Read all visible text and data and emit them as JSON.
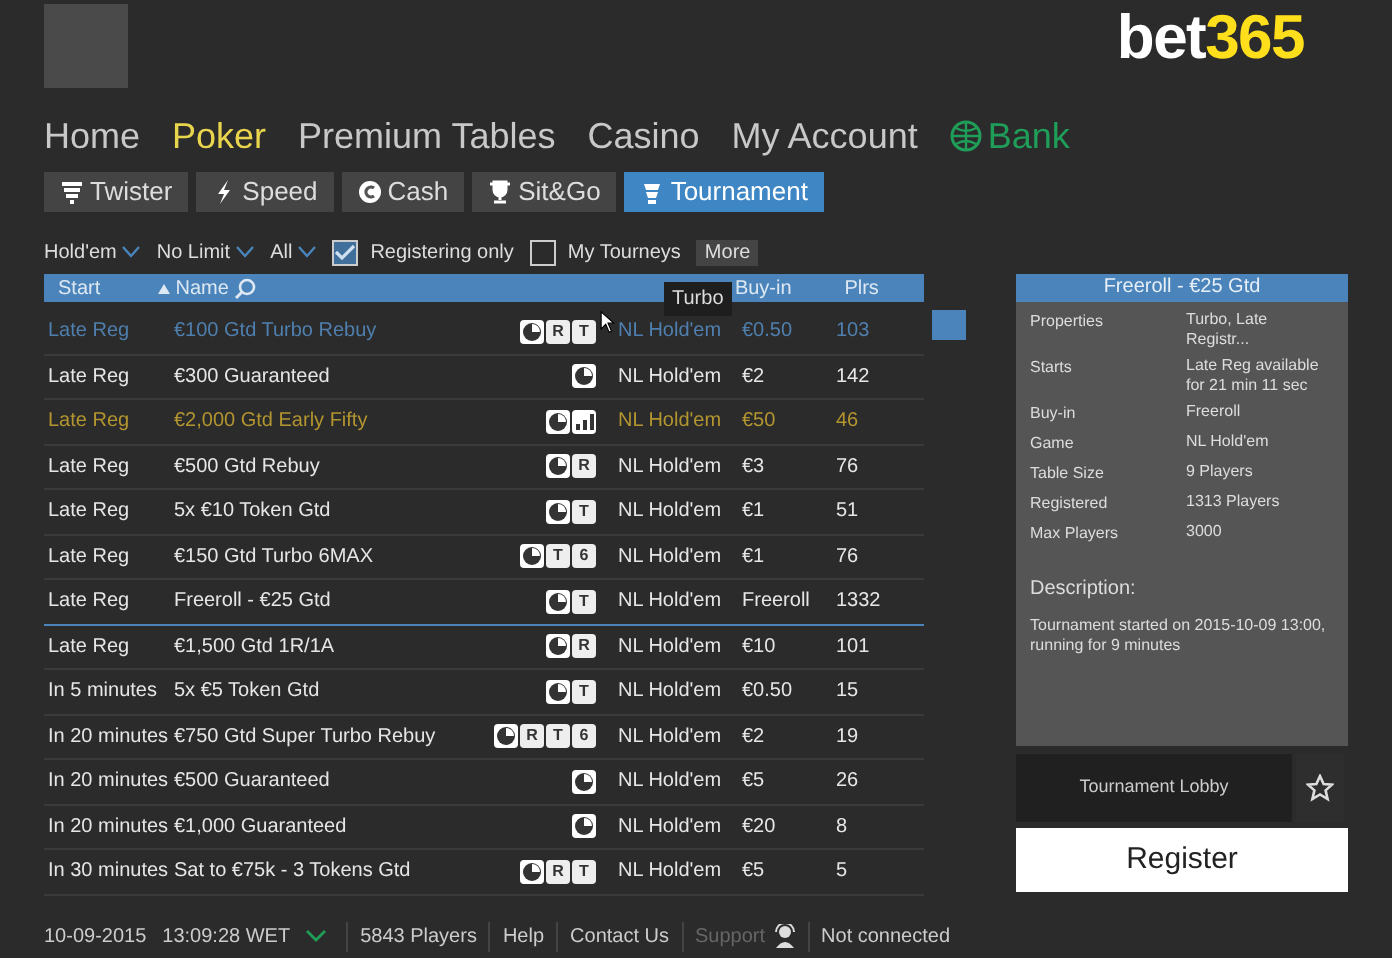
{
  "logo": {
    "main": "bet",
    "accent": "365"
  },
  "nav": [
    {
      "label": "Home",
      "selected": false
    },
    {
      "label": "Poker",
      "selected": true
    },
    {
      "label": "Premium Tables",
      "selected": false
    },
    {
      "label": "Casino",
      "selected": false
    },
    {
      "label": "My Account",
      "selected": false
    },
    {
      "label": "Bank",
      "selected": false,
      "kind": "bank"
    }
  ],
  "tabs": [
    {
      "label": "Twister",
      "selected": false
    },
    {
      "label": "Speed",
      "selected": false
    },
    {
      "label": "Cash",
      "selected": false
    },
    {
      "label": "Sit&Go",
      "selected": false
    },
    {
      "label": "Tournament",
      "selected": true
    }
  ],
  "filters": [
    {
      "kind": "dropdown",
      "label": "Hold'em"
    },
    {
      "kind": "dropdown",
      "label": "No Limit"
    },
    {
      "kind": "dropdown",
      "label": "All"
    },
    {
      "kind": "checkbox",
      "label": "Registering only",
      "checked": true
    },
    {
      "kind": "checkbox",
      "label": "My Tourneys",
      "checked": false
    },
    {
      "kind": "button",
      "label": "More"
    }
  ],
  "table": {
    "columns": [
      "Start",
      "Name",
      "Buy-in",
      "Plrs"
    ],
    "tooltip": "Turbo",
    "rows": [
      {
        "start": "Late Reg",
        "name": "€100 Gtd Turbo Rebuy",
        "badges": [
          {
            "kind": "clock"
          },
          {
            "kind": "letter",
            "text": "R"
          },
          {
            "kind": "letter",
            "text": "T"
          }
        ],
        "game": "NL Hold'em",
        "buyin": "€0.50",
        "players": "103",
        "color": "#4f7fae",
        "selected": false
      },
      {
        "start": "Late Reg",
        "name": "€300 Guaranteed",
        "badges": [
          {
            "kind": "clock"
          }
        ],
        "game": "NL Hold'em",
        "buyin": "€2",
        "players": "142",
        "color": "#e6e6e6",
        "selected": false
      },
      {
        "start": "Late Reg",
        "name": "€2,000 Gtd Early Fifty",
        "badges": [
          {
            "kind": "clock"
          },
          {
            "kind": "bars"
          }
        ],
        "game": "NL Hold'em",
        "buyin": "€50",
        "players": "46",
        "color": "#b3952f",
        "selected": false
      },
      {
        "start": "Late Reg",
        "name": "€500 Gtd Rebuy",
        "badges": [
          {
            "kind": "clock"
          },
          {
            "kind": "letter",
            "text": "R"
          }
        ],
        "game": "NL Hold'em",
        "buyin": "€3",
        "players": "76",
        "color": "#e6e6e6",
        "selected": false
      },
      {
        "start": "Late Reg",
        "name": "5x €10 Token Gtd",
        "badges": [
          {
            "kind": "clock"
          },
          {
            "kind": "letter",
            "text": "T"
          }
        ],
        "game": "NL Hold'em",
        "buyin": "€1",
        "players": "51",
        "color": "#e6e6e6",
        "selected": false
      },
      {
        "start": "Late Reg",
        "name": "€150 Gtd Turbo 6MAX",
        "badges": [
          {
            "kind": "clock"
          },
          {
            "kind": "letter",
            "text": "T"
          },
          {
            "kind": "letter",
            "text": "6"
          }
        ],
        "game": "NL Hold'em",
        "buyin": "€1",
        "players": "76",
        "color": "#e6e6e6",
        "selected": false
      },
      {
        "start": "Late Reg",
        "name": "Freeroll - €25 Gtd",
        "badges": [
          {
            "kind": "clock"
          },
          {
            "kind": "letter",
            "text": "T"
          }
        ],
        "game": "NL Hold'em",
        "buyin": "Freeroll",
        "players": "1332",
        "color": "#e6e6e6",
        "selected": true
      },
      {
        "start": "Late Reg",
        "name": "€1,500 Gtd 1R/1A",
        "badges": [
          {
            "kind": "clock"
          },
          {
            "kind": "letter",
            "text": "R"
          }
        ],
        "game": "NL Hold'em",
        "buyin": "€10",
        "players": "101",
        "color": "#e6e6e6",
        "selected": false
      },
      {
        "start": "In 5 minutes",
        "name": "5x €5 Token Gtd",
        "badges": [
          {
            "kind": "clock"
          },
          {
            "kind": "letter",
            "text": "T"
          }
        ],
        "game": "NL Hold'em",
        "buyin": "€0.50",
        "players": "15",
        "color": "#e6e6e6",
        "selected": false
      },
      {
        "start": "In 20 minutes",
        "name": "€750 Gtd Super Turbo Rebuy",
        "badges": [
          {
            "kind": "clock"
          },
          {
            "kind": "letter",
            "text": "R"
          },
          {
            "kind": "letter",
            "text": "T"
          },
          {
            "kind": "letter",
            "text": "6"
          }
        ],
        "game": "NL Hold'em",
        "buyin": "€2",
        "players": "19",
        "color": "#e6e6e6",
        "selected": false
      },
      {
        "start": "In 20 minutes",
        "name": "€500 Guaranteed",
        "badges": [
          {
            "kind": "clock"
          }
        ],
        "game": "NL Hold'em",
        "buyin": "€5",
        "players": "26",
        "color": "#e6e6e6",
        "selected": false
      },
      {
        "start": "In 20 minutes",
        "name": "€1,000 Guaranteed",
        "badges": [
          {
            "kind": "clock"
          }
        ],
        "game": "NL Hold'em",
        "buyin": "€20",
        "players": "8",
        "color": "#e6e6e6",
        "selected": false
      },
      {
        "start": "In 30 minutes",
        "name": "Sat to €75k - 3 Tokens Gtd",
        "badges": [
          {
            "kind": "clock"
          },
          {
            "kind": "letter",
            "text": "R"
          },
          {
            "kind": "letter",
            "text": "T"
          }
        ],
        "game": "NL Hold'em",
        "buyin": "€5",
        "players": "5",
        "color": "#e6e6e6",
        "selected": false
      }
    ]
  },
  "details": {
    "title": "Freeroll - €25 Gtd",
    "properties": [
      {
        "label": "Properties",
        "value": "Turbo, Late Registr..."
      },
      {
        "label": "Starts",
        "value": "Late Reg available for 21 min 11 sec"
      },
      {
        "label": "Buy-in",
        "value": "Freeroll"
      },
      {
        "label": "Game",
        "value": "NL Hold'em"
      },
      {
        "label": "Table Size",
        "value": "9 Players"
      },
      {
        "label": "Registered",
        "value": "1313 Players"
      },
      {
        "label": "Max Players",
        "value": "3000"
      }
    ],
    "description_label": "Description:",
    "description": "Tournament started on 2015-10-09 13:00, running for 9 minutes",
    "lobby_button": "Tournament Lobby",
    "register_button": "Register"
  },
  "status_bar": [
    {
      "kind": "datetime",
      "date": "10-09-2015",
      "time": "13:09:28 WET"
    },
    {
      "kind": "text",
      "label": "5843 Players"
    },
    {
      "kind": "link",
      "label": "Help"
    },
    {
      "kind": "link",
      "label": "Contact Us"
    },
    {
      "kind": "support",
      "label": "Support",
      "disabled": true
    },
    {
      "kind": "text",
      "label": "Not connected"
    }
  ]
}
